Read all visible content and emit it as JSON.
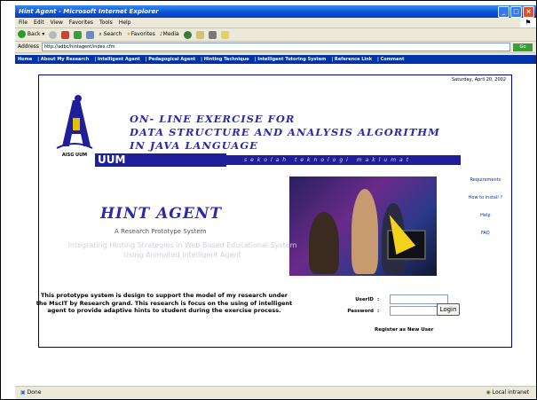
{
  "window": {
    "title": "Hint Agent - Microsoft Internet Explorer",
    "menu": [
      "File",
      "Edit",
      "View",
      "Favorites",
      "Tools",
      "Help"
    ],
    "toolbar": {
      "back": "Back",
      "search": "Search",
      "favorites": "Favorites",
      "media": "Media"
    },
    "address_label": "Address",
    "address": "http://adbc/hintagent/index.cfm",
    "go": "Go",
    "status_left": "Done",
    "status_right": "Local intranet"
  },
  "nav": [
    "Home",
    "| About My Research",
    "| Intelligent Agent",
    "| Pedagogical Agent",
    "| Hinting Technique",
    "| Intelligent Tutoring System",
    "| Reference Link",
    "| Comment"
  ],
  "page": {
    "date": "Saturday, April 20, 2002",
    "headline_1": "ON- LINE EXERCISE FOR",
    "headline_2": "DATA STRUCTURE AND ANALYSIS ALGORITHM",
    "headline_3": "IN JAVA LANGUAGE",
    "logo_caption": "AISG UUM",
    "uum": "UUM",
    "school": "sekolah teknologi maklumat",
    "side_links": [
      "Requirements",
      "How to install ?",
      "Help",
      "FAQ"
    ],
    "hint_title": "HINT AGENT",
    "prototype": "A Research Prototype System",
    "tagline": "Integrating Hinting Strategies in Web-Based Educational System Using Animated Intelligent Agent",
    "description": "This prototype system is design to support the model of my research under the MscIT by Research grand. This research is focus on the using of intelligent agent to provide adaptive hints to student during the exercise process.",
    "userid_label": "UserID",
    "password_label": "Password",
    "colon": ":",
    "login_button": "Login",
    "register": "Register as New User"
  },
  "colors": {
    "nav_bg": "#0033aa",
    "title_blue": "#2a2aaa",
    "photo_arrow": "#f2d21a"
  }
}
